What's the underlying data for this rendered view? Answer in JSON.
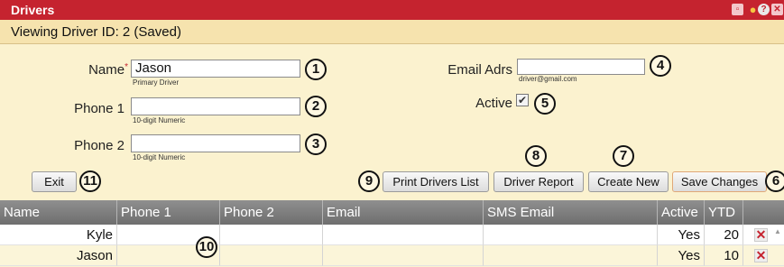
{
  "window": {
    "title": "Drivers"
  },
  "status": {
    "text": "Viewing Driver ID: 2 (Saved)"
  },
  "form": {
    "name_label": "Name",
    "name_required": "*",
    "name_value": "Jason",
    "name_hint": "Primary Driver",
    "phone1_label": "Phone 1",
    "phone1_value": "",
    "phone1_hint": "10-digit Numeric",
    "phone2_label": "Phone 2",
    "phone2_value": "",
    "phone2_hint": "10-digit Numeric",
    "email_label": "Email Adrs",
    "email_value": "",
    "email_hint": "driver@gmail.com",
    "active_label": "Active",
    "active_checked": true
  },
  "buttons": {
    "exit": "Exit",
    "print_list": "Print Drivers List",
    "driver_report": "Driver Report",
    "create_new": "Create New",
    "save_changes": "Save Changes"
  },
  "callouts": [
    "1",
    "2",
    "3",
    "4",
    "5",
    "6",
    "7",
    "8",
    "9",
    "10",
    "11"
  ],
  "grid": {
    "columns": [
      "Name",
      "Phone 1",
      "Phone 2",
      "Email",
      "SMS Email",
      "Active",
      "YTD"
    ],
    "rows": [
      {
        "name": "Kyle",
        "phone1": "",
        "phone2": "",
        "email": "",
        "sms": "",
        "active": "Yes",
        "ytd": "20"
      },
      {
        "name": "Jason",
        "phone1": "",
        "phone2": "",
        "email": "",
        "sms": "",
        "active": "Yes",
        "ytd": "10"
      }
    ]
  },
  "icons": [
    "window-icon",
    "pin-icon",
    "help-icon",
    "close-icon",
    "checkmark-icon",
    "delete-icon"
  ],
  "colors": {
    "titlebar": "#c5232f",
    "background": "#fbf2cf",
    "status_bar": "#f6e3ae",
    "grid_header": "#7d7d7d",
    "delete_x": "#c5232f"
  }
}
